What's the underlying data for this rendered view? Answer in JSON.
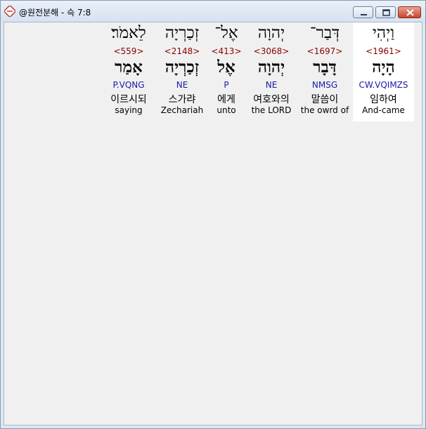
{
  "window": {
    "title": "@원전분해 - 슥 7:8"
  },
  "words": [
    {
      "hebrew": "וַיְהִי",
      "strong": "<1961>",
      "lemma": "הָיָה",
      "parse": "CW.VQIMZS",
      "korean": "임하여",
      "english": "And-came"
    },
    {
      "hebrew": "דְּבַר־",
      "strong": "<1697>",
      "lemma": "דָּבָר",
      "parse": "NMSG",
      "korean": "말씀이",
      "english": "the owrd of"
    },
    {
      "hebrew": "יְהוָה",
      "strong": "<3068>",
      "lemma": "יְהוָה",
      "parse": "NE",
      "korean": "여호와의",
      "english": "the LORD"
    },
    {
      "hebrew": "אֶל־",
      "strong": "<413>",
      "lemma": "אֶל",
      "parse": "P",
      "korean": "에게",
      "english": "unto"
    },
    {
      "hebrew": "זְכַרְיָה",
      "strong": "<2148>",
      "lemma": "זְכַרְיָה",
      "parse": "NE",
      "korean": "스가랴",
      "english": "Zechariah"
    },
    {
      "hebrew": "לֵאמֹר׃",
      "strong": "<559>",
      "lemma": "אָמַר",
      "parse": "P.VQNG",
      "korean": "이르시되",
      "english": "saying"
    }
  ]
}
